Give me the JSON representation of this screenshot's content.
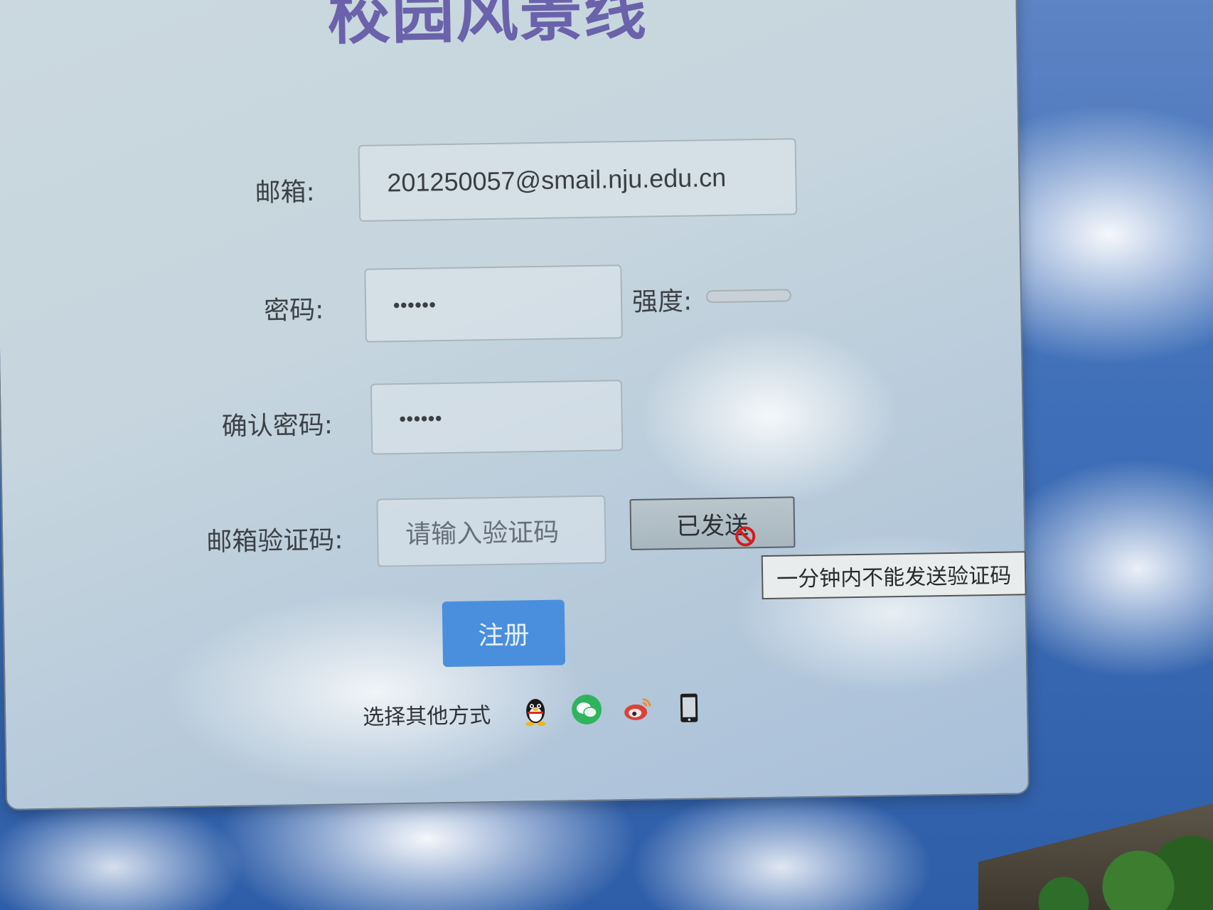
{
  "title": "校园风景线",
  "form": {
    "email_label": "邮箱:",
    "email_value": "201250057@smail.nju.edu.cn",
    "password_label": "密码:",
    "password_value": "••••••",
    "strength_label": "强度:",
    "confirm_label": "确认密码:",
    "confirm_value": "••••••",
    "code_label": "邮箱验证码:",
    "code_placeholder": "请输入验证码",
    "sent_button": "已发送",
    "tooltip": "一分钟内不能发送验证码",
    "register_button": "注册"
  },
  "other_methods": {
    "label": "选择其他方式",
    "icons": [
      "qq-icon",
      "wechat-icon",
      "weibo-icon",
      "phone-icon"
    ]
  },
  "colors": {
    "title": "#6a62aa",
    "register_button": "#4a8fde",
    "wechat": "#2fb35c",
    "weibo": "#d8423a"
  }
}
